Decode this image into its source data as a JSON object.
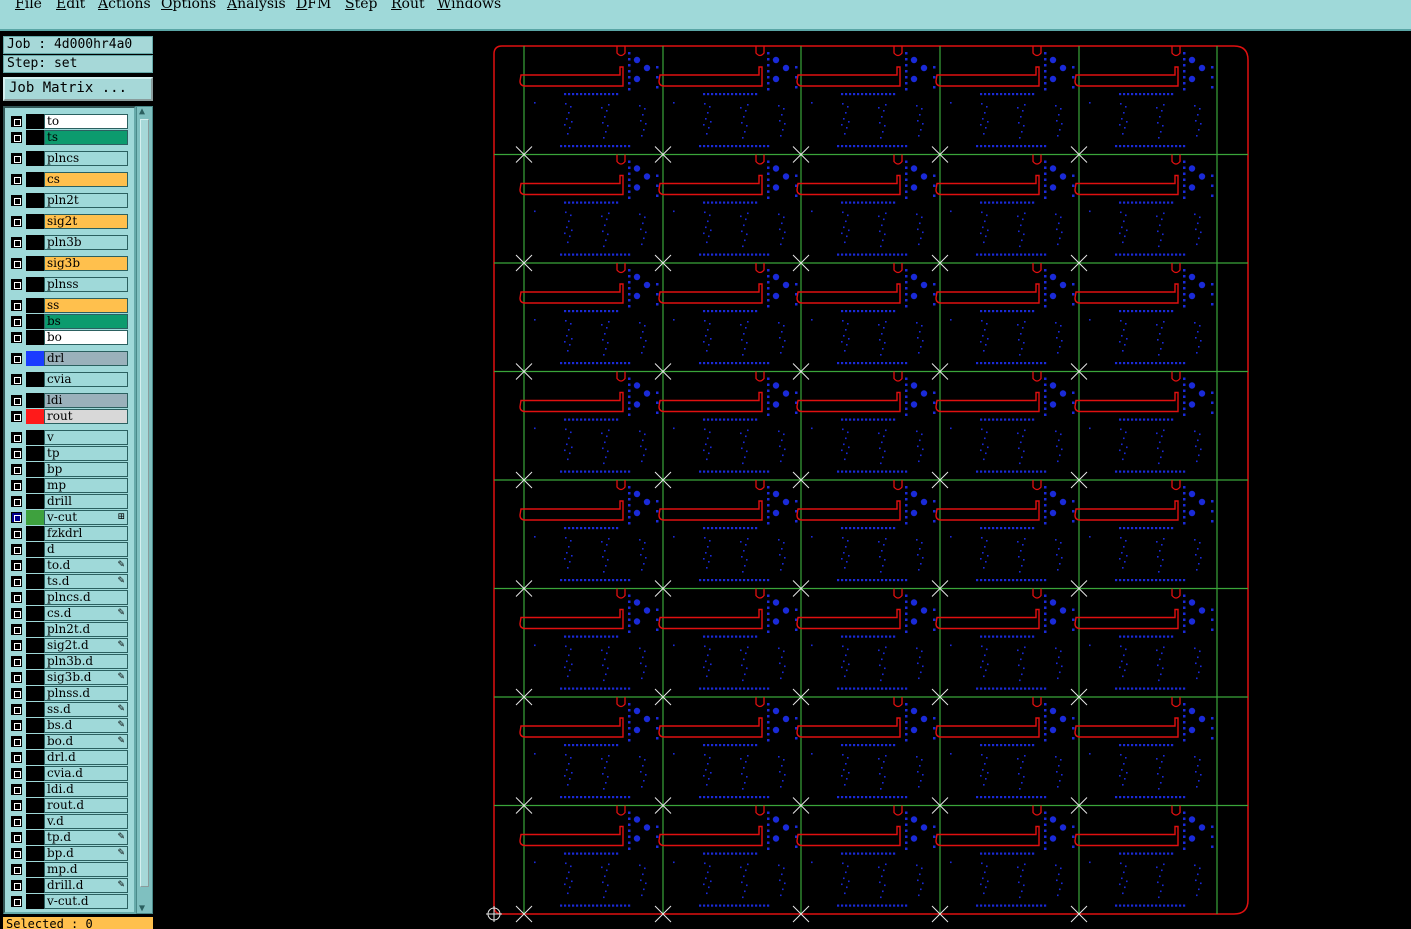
{
  "menubar": {
    "items": [
      {
        "label": "File",
        "mnemonic": "F",
        "rest": "ile"
      },
      {
        "label": "Edit",
        "mnemonic": "E",
        "rest": "dit"
      },
      {
        "label": "Actions",
        "mnemonic": "A",
        "rest": "ctions"
      },
      {
        "label": "Options",
        "mnemonic": "O",
        "rest": "ptions"
      },
      {
        "label": "Analysis",
        "mnemonic": "A",
        "rest": "nalysis"
      },
      {
        "label": "DFM",
        "mnemonic": "D",
        "rest": "FM"
      },
      {
        "label": "Step",
        "mnemonic": "S",
        "rest": "tep"
      },
      {
        "label": "Rout",
        "mnemonic": "R",
        "rest": "out"
      },
      {
        "label": "Windows",
        "mnemonic": "W",
        "rest": "indows"
      }
    ]
  },
  "panel": {
    "job_label": "Job : 4d000hr4a0",
    "step_label": "Step: set",
    "matrix_button": "Job Matrix ...",
    "status": "Selected : 0"
  },
  "colors": {
    "white": "#ffffff",
    "green": "#0c9b6e",
    "cyan": "#9fd9d9",
    "orange": "#ffc04d",
    "gray": "#9ab1bb",
    "lightgray": "#d8d8d8",
    "board_outline": "#e01010",
    "grid_line": "#3aa53a",
    "pads": "#1a2ad8"
  },
  "layers": [
    {
      "name": "to",
      "bg": "white"
    },
    {
      "name": "ts",
      "bg": "green"
    },
    {
      "name": "plncs",
      "bg": "cyan"
    },
    {
      "name": "cs",
      "bg": "orange"
    },
    {
      "name": "pln2t",
      "bg": "cyan"
    },
    {
      "name": "sig2t",
      "bg": "orange"
    },
    {
      "name": "pln3b",
      "bg": "cyan"
    },
    {
      "name": "sig3b",
      "bg": "orange"
    },
    {
      "name": "plnss",
      "bg": "cyan"
    },
    {
      "name": "ss",
      "bg": "orange"
    },
    {
      "name": "bs",
      "bg": "green"
    },
    {
      "name": "bo",
      "bg": "white"
    },
    {
      "name": "drl",
      "bg": "gray",
      "swatch": "#1a3cff"
    },
    {
      "name": "cvia",
      "bg": "cyan"
    },
    {
      "name": "ldi",
      "bg": "gray"
    },
    {
      "name": "rout",
      "bg": "lightgray",
      "swatch": "#ff1a1a"
    },
    {
      "name": "v",
      "bg": "cyan"
    },
    {
      "name": "tp",
      "bg": "cyan"
    },
    {
      "name": "bp",
      "bg": "cyan"
    },
    {
      "name": "mp",
      "bg": "cyan"
    },
    {
      "name": "drill",
      "bg": "cyan"
    },
    {
      "name": "v-cut",
      "bg": "cyan",
      "swatch": "#3ea13e",
      "active": true,
      "mark": "⊞"
    },
    {
      "name": "fzkdrl",
      "bg": "cyan"
    },
    {
      "name": "d",
      "bg": "cyan"
    },
    {
      "name": "to.d",
      "bg": "cyan",
      "mark": "✎"
    },
    {
      "name": "ts.d",
      "bg": "cyan",
      "mark": "✎"
    },
    {
      "name": "plncs.d",
      "bg": "cyan"
    },
    {
      "name": "cs.d",
      "bg": "cyan",
      "mark": "✎"
    },
    {
      "name": "pln2t.d",
      "bg": "cyan"
    },
    {
      "name": "sig2t.d",
      "bg": "cyan",
      "mark": "✎"
    },
    {
      "name": "pln3b.d",
      "bg": "cyan"
    },
    {
      "name": "sig3b.d",
      "bg": "cyan",
      "mark": "✎"
    },
    {
      "name": "plnss.d",
      "bg": "cyan"
    },
    {
      "name": "ss.d",
      "bg": "cyan",
      "mark": "✎"
    },
    {
      "name": "bs.d",
      "bg": "cyan",
      "mark": "✎"
    },
    {
      "name": "bo.d",
      "bg": "cyan",
      "mark": "✎"
    },
    {
      "name": "drl.d",
      "bg": "cyan"
    },
    {
      "name": "cvia.d",
      "bg": "cyan"
    },
    {
      "name": "ldi.d",
      "bg": "cyan"
    },
    {
      "name": "rout.d",
      "bg": "cyan"
    },
    {
      "name": "v.d",
      "bg": "cyan"
    },
    {
      "name": "tp.d",
      "bg": "cyan",
      "mark": "✎"
    },
    {
      "name": "bp.d",
      "bg": "cyan",
      "mark": "✎"
    },
    {
      "name": "mp.d",
      "bg": "cyan"
    },
    {
      "name": "drill.d",
      "bg": "cyan",
      "mark": "✎"
    },
    {
      "name": "v-cut.d",
      "bg": "cyan"
    }
  ],
  "board": {
    "columns": 5,
    "rows": 8,
    "icons": {
      "origin": "origin-crosshair-icon",
      "vcut": "x-cross-marker-icon"
    }
  }
}
